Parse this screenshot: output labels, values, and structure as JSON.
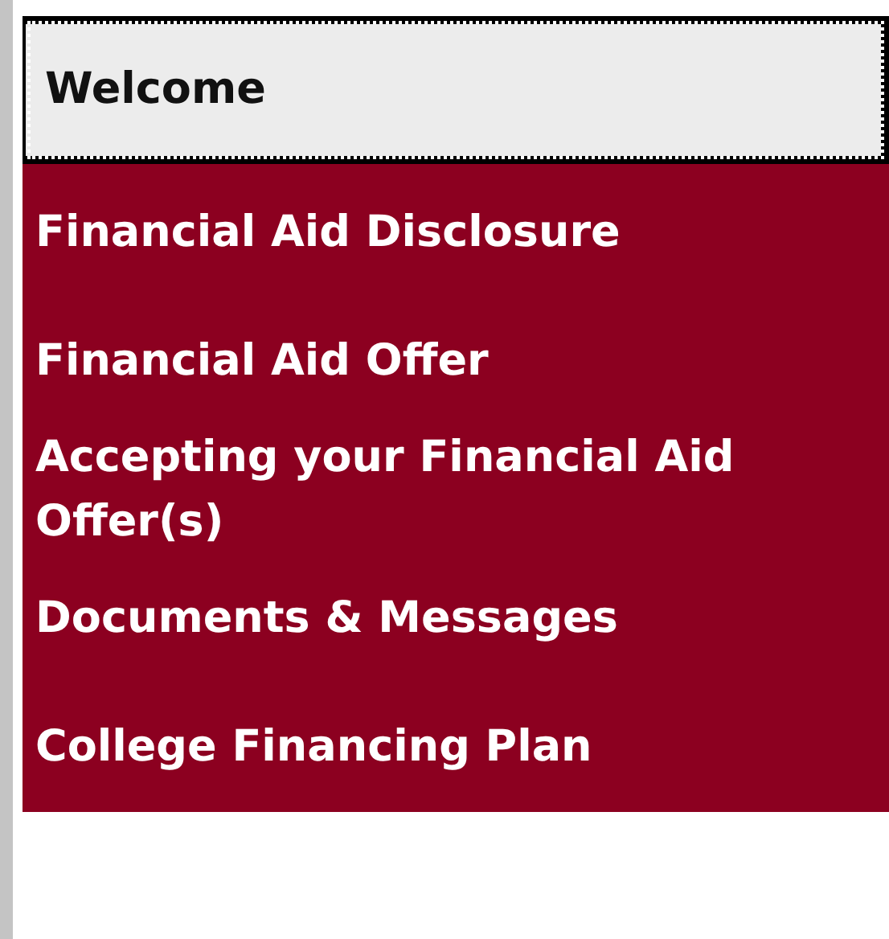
{
  "menu": [
    {
      "label": "Welcome",
      "selected": true
    },
    {
      "label": "Financial Aid Disclosure",
      "selected": false
    },
    {
      "label": "Financial Aid Offer",
      "selected": false
    },
    {
      "label": "Accepting your Financial Aid Offer(s)",
      "selected": false
    },
    {
      "label": "Documents & Messages",
      "selected": false
    },
    {
      "label": "College Financing Plan",
      "selected": false
    }
  ]
}
